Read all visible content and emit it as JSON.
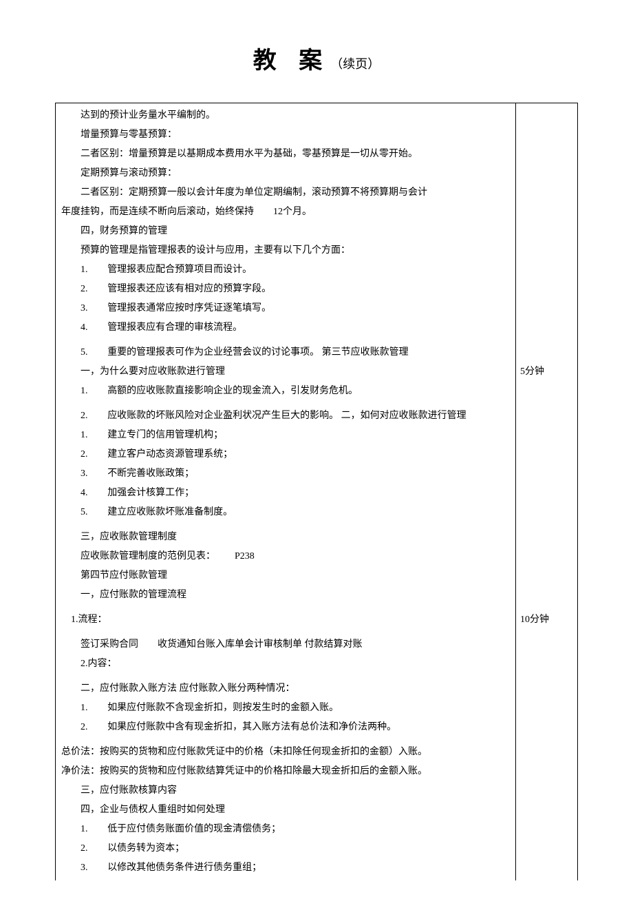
{
  "header": {
    "title_main": "教 案",
    "title_sub": "（续页）"
  },
  "sections": [
    {
      "time": "",
      "lines": [
        {
          "indent": 1,
          "text": "达到的预计业务量水平编制的。"
        },
        {
          "indent": 1,
          "text": "增量预算与零基预算："
        },
        {
          "indent": 1,
          "text": "二者区别：增量预算是以基期成本费用水平为基础，零基预算是一切从零开始。"
        },
        {
          "indent": 1,
          "text": "定期预算与滚动预算："
        },
        {
          "indent": 1,
          "text": "二者区别：定期预算一般以会计年度为单位定期编制，滚动预算不将预算期与会计"
        },
        {
          "indent": 0,
          "text": "年度挂钩，而是连续不断向后滚动，始终保持  12个月。"
        },
        {
          "indent": 1,
          "text": "四，财务预算的管理"
        },
        {
          "indent": 1,
          "text": "预算的管理是指管理报表的设计与应用，主要有以下几个方面："
        },
        {
          "indent": 1,
          "num": "1.",
          "text": "管理报表应配合预算项目而设计。"
        },
        {
          "indent": 1,
          "num": "2.",
          "text": "管理报表还应该有相对应的预算字段。"
        },
        {
          "indent": 1,
          "num": "3.",
          "text": "管理报表通常应按时序凭证逐笔填写。"
        },
        {
          "indent": 1,
          "num": "4.",
          "text": "管理报表应有合理的审核流程。"
        }
      ]
    },
    {
      "time": "5分钟",
      "lines": [
        {
          "indent": 1,
          "num": "5.",
          "text": "重要的管理报表可作为企业经营会议的讨论事项。 第三节应收账款管理"
        },
        {
          "indent": 1,
          "text": "一，为什么要对应收账款进行管理"
        },
        {
          "indent": 1,
          "num": "1.",
          "text": "高额的应收账款直接影响企业的现金流入，引发财务危机。"
        }
      ]
    },
    {
      "time": "",
      "lines": [
        {
          "indent": 1,
          "num": "2.",
          "text": "应收账款的坏账风险对企业盈利状况产生巨大的影响。 二，如何对应收账款进行管理"
        },
        {
          "indent": 1,
          "num": "1.",
          "text": "建立专门的信用管理机构；"
        },
        {
          "indent": 1,
          "num": "2.",
          "text": "建立客户动态资源管理系统；"
        },
        {
          "indent": 1,
          "num": "3.",
          "text": "不断完善收账政策；"
        },
        {
          "indent": 1,
          "num": "4.",
          "text": "加强会计核算工作；"
        },
        {
          "indent": 1,
          "num": "5.",
          "text": "建立应收账款坏账准备制度。"
        }
      ]
    },
    {
      "time": "",
      "lines": [
        {
          "indent": 1,
          "text": "三，应收账款管理制度"
        },
        {
          "indent": 1,
          "text": "应收账款管理制度的范例见表：  P238"
        },
        {
          "indent": 1,
          "text": "第四节应付账款管理"
        },
        {
          "indent": 1,
          "text": "一，应付账款的管理流程"
        }
      ]
    },
    {
      "time": "10分钟",
      "lines": [
        {
          "indent": 0,
          "text": " 1.流程："
        }
      ]
    },
    {
      "time": "",
      "lines": [
        {
          "indent": 1,
          "text": "签订采购合同  收货通知台账入库单会计审核制单 付款结算对账"
        },
        {
          "indent": 1,
          "text": "2.内容："
        }
      ]
    },
    {
      "time": "",
      "lines": [
        {
          "indent": 1,
          "text": "二，应付账款入账方法 应付账款入账分两种情况："
        },
        {
          "indent": 1,
          "num": "1.",
          "text": "如果应付账款不含现金折扣，则按发生时的金额入账。"
        },
        {
          "indent": 1,
          "num": "2.",
          "text": "如果应付账款中含有现金折扣，其入账方法有总价法和净价法两种。"
        }
      ]
    },
    {
      "time": "",
      "lines": [
        {
          "indent": 0,
          "text": "总价法：按购买的货物和应付账款凭证中的价格（未扣除任何现金折扣的金额）入账。"
        },
        {
          "indent": 0,
          "text": "净价法：按购买的货物和应付账款结算凭证中的价格扣除最大现金折扣后的金额入账。"
        },
        {
          "indent": 1,
          "text": "三，应付账款核算内容"
        },
        {
          "indent": 1,
          "text": "四，企业与债权人重组时如何处理"
        },
        {
          "indent": 1,
          "num": "1.",
          "text": "低于应付债务账面价值的现金清偿债务；"
        },
        {
          "indent": 1,
          "num": "2.",
          "text": "以债务转为资本；"
        },
        {
          "indent": 1,
          "num": "3.",
          "text": "以修改其他债务条件进行债务重组；"
        }
      ]
    }
  ]
}
